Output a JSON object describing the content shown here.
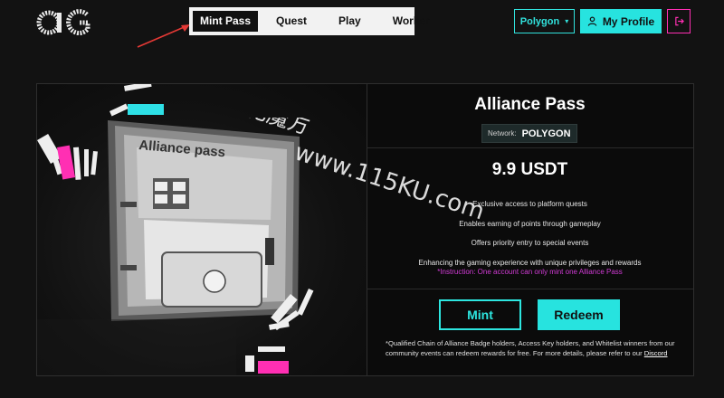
{
  "brand": {
    "logo_text": "aG"
  },
  "nav": {
    "items": [
      "Mint Pass",
      "Quest",
      "Play",
      "Worker"
    ],
    "active": "Mint Pass"
  },
  "header": {
    "network_label": "Polygon",
    "profile_label": "My Profile"
  },
  "pass": {
    "title": "Alliance Pass",
    "network_label": "Network:",
    "network_value": "POLYGON",
    "price": "9.9 USDT",
    "features": [
      "Exclusive access to platform quests",
      "Enables earning of points through gameplay",
      "Offers priority entry to special events",
      "Enhancing the gaming experience with unique privileges and rewards"
    ],
    "instruction": "*Instruction: One account can only mint one Alliance Pass",
    "mint_label": "Mint",
    "redeem_label": "Redeem",
    "note": "*Qualified Chain of Alliance Badge holders, Access Key holders, and Whitelist winners from our community events can redeem rewards for free. For more details, please refer to our",
    "note_link": "Discord",
    "card_art_text": "Alliance pass"
  },
  "watermark": {
    "line1": "量化魔方",
    "line2": "www.115KU.com"
  },
  "colors": {
    "accent": "#27e3df",
    "magenta": "#ff2fb3",
    "instruction": "#d23bd6"
  }
}
